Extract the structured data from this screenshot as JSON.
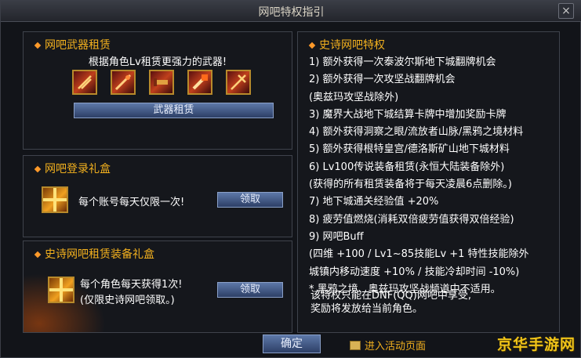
{
  "window": {
    "title": "网吧特权指引",
    "close_icon": "close-icon"
  },
  "weapon_rent": {
    "title": "网吧武器租赁",
    "subtitle": "根据角色Lv租赁更强力的武器!",
    "weapons": [
      "weapon-icon",
      "weapon-icon",
      "weapon-icon",
      "weapon-icon",
      "weapon-icon"
    ],
    "button_label": "武器租赁"
  },
  "login_gift": {
    "title": "网吧登录礼盒",
    "text": "每个账号每天仅限一次!",
    "button_label": "领取"
  },
  "epic_gift": {
    "title": "史诗网吧租赁装备礼盒",
    "text_line1": "每个角色每天获得1次!",
    "text_line2": "(仅限史诗网吧领取。)",
    "button_label": "领取"
  },
  "privileges": {
    "title": "史诗网吧特权",
    "items": [
      "1) 额外获得一次泰波尔斯地下城翻牌机会",
      "2) 额外获得一次攻坚战翻牌机会",
      "(奥兹玛攻坚战除外)",
      "3) 魔界大战地下城结算卡牌中增加奖励卡牌",
      "4) 额外获得洞察之眼/流放者山脉/黑鸦之境材料",
      "5) 额外获得根特皇宫/德洛斯矿山地下城材料",
      "6) Lv100传说装备租赁(永恒大陆装备除外)",
      "(获得的所有租赁装备将于每天凌晨6点删除。)",
      "7) 地下城通关经验值 +20%",
      "8) 疲劳值燃烧(消耗双倍疲劳值获得双倍经验)",
      "9) 网吧Buff",
      "(四维 +100 / Lv1~85技能Lv +1 特性技能除外",
      "城镇内移动速度 +10% / 技能冷却时间 -10%)",
      "* 黑鸦之境、奥兹玛攻坚战频道中不适用。"
    ],
    "notice_line1": "该特权只能在DNF(QQ)网吧中享受,",
    "notice_line2": "奖励将发放给当前角色。"
  },
  "footer": {
    "ok_label": "确定",
    "link_label": "进入活动页面"
  },
  "watermark": "京华手游网",
  "colors": {
    "accent": "#f2b01e",
    "text": "#ffffff",
    "button": "#3a5180"
  }
}
